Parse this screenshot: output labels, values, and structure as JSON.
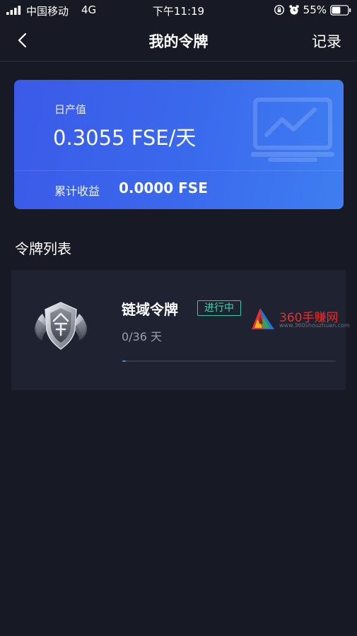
{
  "status_bar": {
    "carrier": "中国移动",
    "network": "4G",
    "time": "下午11:19",
    "battery": "55%",
    "battery_level": 0.55,
    "icons": [
      "signal-icon",
      "rotation-lock-icon",
      "alarm-icon",
      "battery-icon"
    ]
  },
  "nav": {
    "back_icon": "chevron-left-icon",
    "title": "我的令牌",
    "records": "记录"
  },
  "summary": {
    "daily_output_label": "日产值",
    "daily_output_value": "0.3055 FSE/天",
    "cumulative_label": "累计收益",
    "cumulative_value": "0.0000 FSE",
    "watermark_icon": "chart-monitor-icon",
    "gradient_start": "#3b5ae8",
    "gradient_end": "#3e7ef1"
  },
  "token_list": {
    "title": "令牌列表",
    "items": [
      {
        "name": "链域令牌",
        "status": "进行中",
        "progress_text": "0/36 天",
        "progress_fraction": 0.015,
        "badge_icon": "silver-shield-badge-icon"
      }
    ]
  },
  "watermark": {
    "text": "360手赚网",
    "url": "www.360shouzhuan.com"
  },
  "colors": {
    "background": "#171a25",
    "card": "#1f2230",
    "accent_blue": "#2d8cff",
    "status_green": "#3cd8ad",
    "watermark_red": "#e2312f"
  }
}
